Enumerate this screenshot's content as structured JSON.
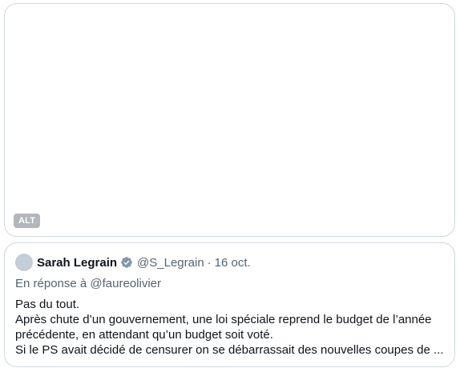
{
  "media": {
    "alt_label": "ALT"
  },
  "quote": {
    "author_name": "Sarah Legrain",
    "handle": "@S_Legrain",
    "separator": "·",
    "date": "16 oct.",
    "reply_to": "En réponse à @faureolivier",
    "lines": [
      "Pas du tout.",
      "Après chute d’un gouvernement, une loi spéciale reprend le budget de l’année",
      "précédente, en attendant qu’un budget soit voté.",
      "Si le PS avait décidé de censurer on se débarrassait des nouvelles coupes de ..."
    ]
  },
  "colors": {
    "border": "#cfd9de",
    "secondary_text": "#536471",
    "primary_text": "#0f1419",
    "verified_badge": "#829aab",
    "avatar_placeholder": "#c3ced6",
    "alt_badge": "#b3b7bb"
  },
  "icons": {
    "verified": "verified-badge-icon"
  }
}
